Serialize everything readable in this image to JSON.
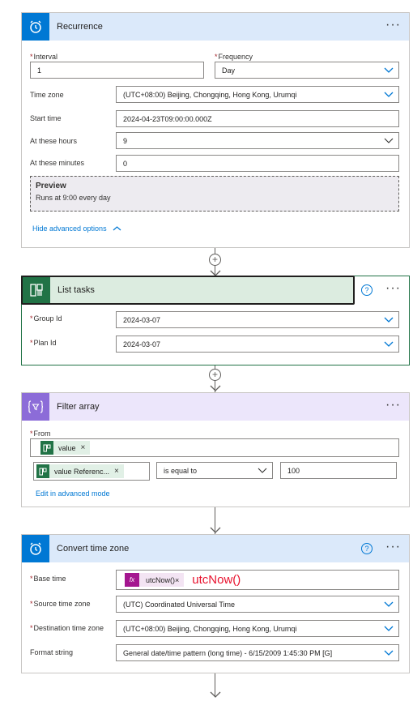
{
  "recurrence": {
    "title": "Recurrence",
    "more": "···",
    "interval_label": "Interval",
    "interval_value": "1",
    "frequency_label": "Frequency",
    "frequency_value": "Day",
    "timezone_label": "Time zone",
    "timezone_value": "(UTC+08:00) Beijing, Chongqing, Hong Kong, Urumqi",
    "starttime_label": "Start time",
    "starttime_value": "2024-04-23T09:00:00.000Z",
    "hours_label": "At these hours",
    "hours_value": "9",
    "minutes_label": "At these minutes",
    "minutes_value": "0",
    "preview_title": "Preview",
    "preview_text": "Runs at 9:00 every day",
    "hide_advanced": "Hide advanced options",
    "accent": "#dbe9fa",
    "icon_bg": "#0078d4"
  },
  "list_tasks": {
    "title": "List tasks",
    "help": "?",
    "more": "···",
    "group_label": "Group Id",
    "group_value": "2024-03-07",
    "plan_label": "Plan Id",
    "plan_value": "2024-03-07",
    "accent": "#dcece0",
    "icon_bg": "#217346"
  },
  "filter_array": {
    "title": "Filter array",
    "more": "···",
    "from_label": "From",
    "from_token": "value",
    "left_token": "value Referenc...",
    "operator": "is equal to",
    "right_value": "100",
    "edit_advanced": "Edit in advanced mode",
    "accent": "#ece6fb",
    "icon_bg": "#8c6cd8"
  },
  "convert_tz": {
    "title": "Convert time zone",
    "help": "?",
    "more": "···",
    "base_label": "Base time",
    "base_token": "utcNow()",
    "base_annotation": "utcNow()",
    "source_label": "Source time zone",
    "source_value": "(UTC) Coordinated Universal Time",
    "dest_label": "Destination time zone",
    "dest_value": "(UTC+08:00) Beijing, Chongqing, Hong Kong, Urumqi",
    "format_label": "Format string",
    "format_value": "General date/time pattern (long time) - 6/15/2009 1:45:30 PM [G]",
    "accent": "#dbe9fa",
    "icon_bg": "#0078d4"
  },
  "common": {
    "required_mark": "*",
    "token_remove": "×",
    "plus": "+"
  }
}
